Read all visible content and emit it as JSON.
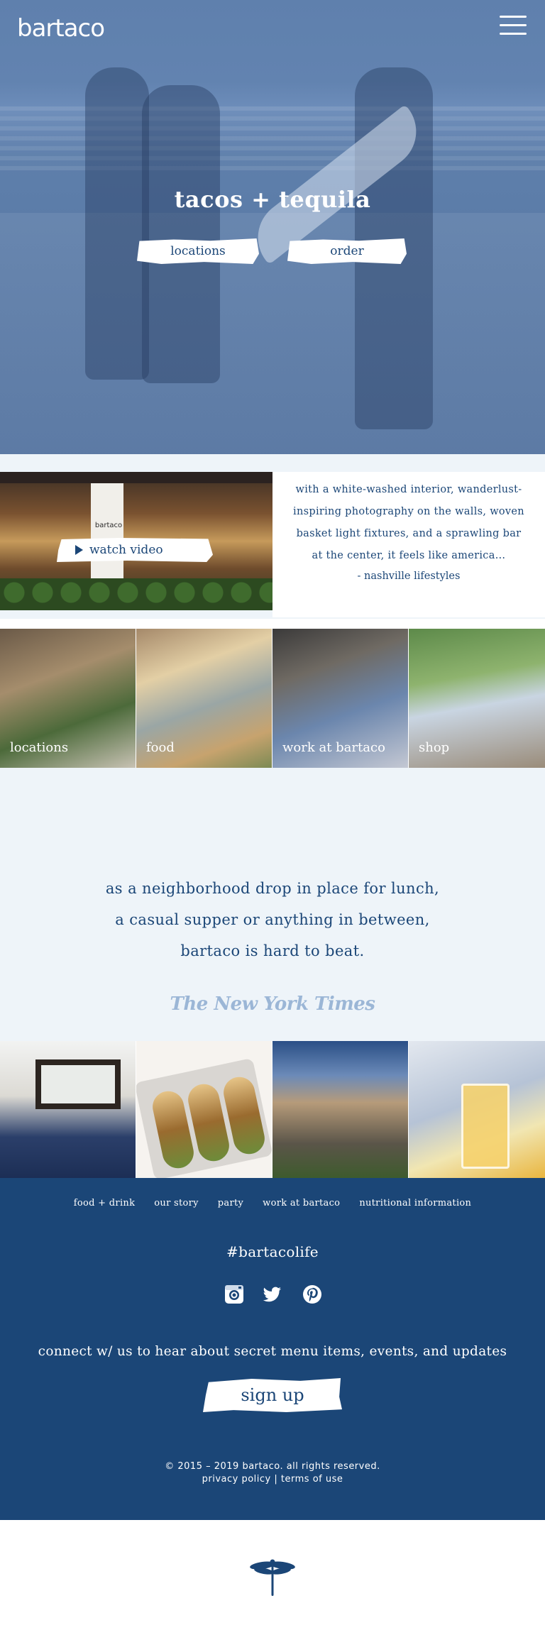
{
  "header": {
    "logo_text": "bartaco",
    "menu_icon": "hamburger-menu-icon"
  },
  "hero": {
    "title": "tacos + tequila",
    "buttons": {
      "locations": "locations",
      "order": "order"
    }
  },
  "video": {
    "watch_label": "watch video",
    "play_icon": "play-icon",
    "sign_text": "bartaco"
  },
  "press_quote": {
    "text": "with a white-washed interior, wanderlust-inspiring photography on the walls, woven basket light fixtures, and a sprawling bar at the center, it feels like america…",
    "attribution": "- nashville lifestyles"
  },
  "tiles": [
    {
      "label": "locations"
    },
    {
      "label": "food"
    },
    {
      "label": "work at bartaco"
    },
    {
      "label": "shop"
    }
  ],
  "review": {
    "text": "as a neighborhood drop in place for lunch, a casual supper or anything in between, bartaco is hard to beat.",
    "source": "The New York Times"
  },
  "footer": {
    "nav": [
      "food + drink",
      "our story",
      "party",
      "work at bartaco",
      "nutritional information"
    ],
    "hashtag": "#bartacolife",
    "social_icons": [
      "instagram-icon",
      "twitter-icon",
      "pinterest-icon"
    ],
    "connect_text": "connect w/ us to hear about secret menu items, events, and updates",
    "signup_label": "sign up",
    "copyright": "© 2015 – 2019 bartaco. all rights reserved.",
    "privacy": "privacy policy",
    "separator": "|",
    "terms": "terms of use"
  },
  "colors": {
    "brand_blue": "#1b4677",
    "light_bg": "#eef4f9",
    "nyt_logo": "#9bb6d6"
  }
}
